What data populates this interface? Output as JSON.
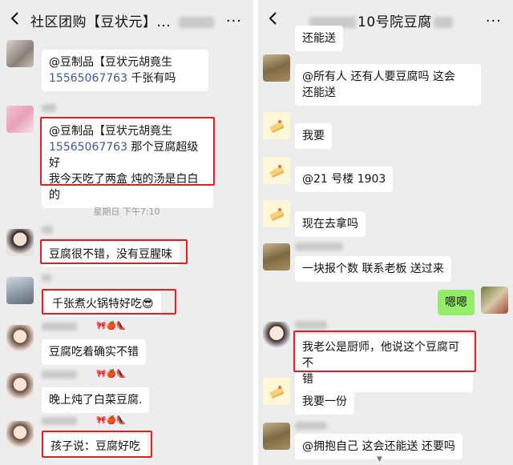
{
  "left": {
    "title": "社区团购【豆状元】...",
    "more": "···",
    "timestamp": "星期日 下午7:10",
    "messages": [
      {
        "text": "@豆制品【豆状元胡竟生",
        "phone": "15565067763",
        "after": " 千张有吗"
      },
      {
        "line1": "@豆制品【豆状元胡竟生",
        "phone": "15565067763",
        "after": " 那个豆腐超级好",
        "line3": "我今天吃了两盒 炖的汤是白白",
        "line4": "的"
      },
      {
        "text": "豆腐很不错，没有豆腥味"
      },
      {
        "text": "千张煮火锅特好吃😎"
      },
      {
        "text": "豆腐吃着确实不错"
      },
      {
        "text": "晚上炖了白菜豆腐."
      },
      {
        "text": "孩子说：豆腐好吃"
      }
    ],
    "nick_decoration": "🎀🍎👠"
  },
  "right": {
    "title_suffix": "10号院豆腐",
    "more": "···",
    "messages": [
      {
        "text": "还能送"
      },
      {
        "line1": "@所有人     还有人要豆腐吗 这会",
        "line2": "还能送"
      },
      {
        "text": "我要"
      },
      {
        "text": "@21 号楼 1903"
      },
      {
        "text": "现在去拿吗"
      },
      {
        "text": "一块报个数 联系老板 送过来"
      },
      {
        "text": "嗯嗯"
      },
      {
        "line1": "我老公是厨师，他说这个豆腐可不",
        "line2": "错"
      },
      {
        "text": "我要一份"
      },
      {
        "text": "@拥抱自己   这会还能送  还要吗"
      }
    ]
  },
  "colors": {
    "highlight": "#e02020",
    "own_bubble": "#95ec69",
    "chat_bg": "#ededed",
    "phone_link": "#3b5998"
  },
  "icons": [
    "back-arrow-icon",
    "more-icon",
    "cake-avatar-icon",
    "scroll-down-icon"
  ]
}
